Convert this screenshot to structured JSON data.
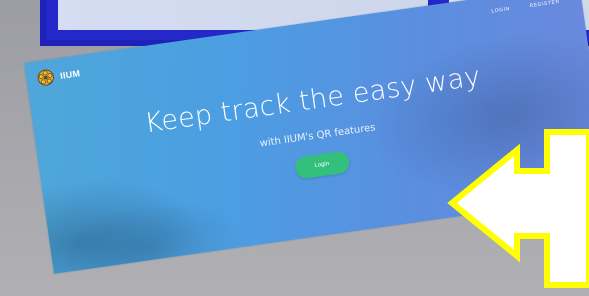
{
  "nav": {
    "brand": "IIUM",
    "links": [
      "LOGIN",
      "REGISTER"
    ]
  },
  "hero": {
    "title": "Keep track the easy way",
    "subtitle": "with IIUM's QR features",
    "button_label": "Login"
  },
  "colors": {
    "frame": "#1e22b9",
    "hero_gradient_start": "#4fa7d9",
    "hero_gradient_end": "#6b88dc",
    "button": "#33c07c",
    "arrow_fill": "#ffffff",
    "arrow_stroke": "#ffff00"
  },
  "icons": {
    "brand_logo": "iium-logo-icon",
    "callout": "left-arrow-callout-icon"
  }
}
